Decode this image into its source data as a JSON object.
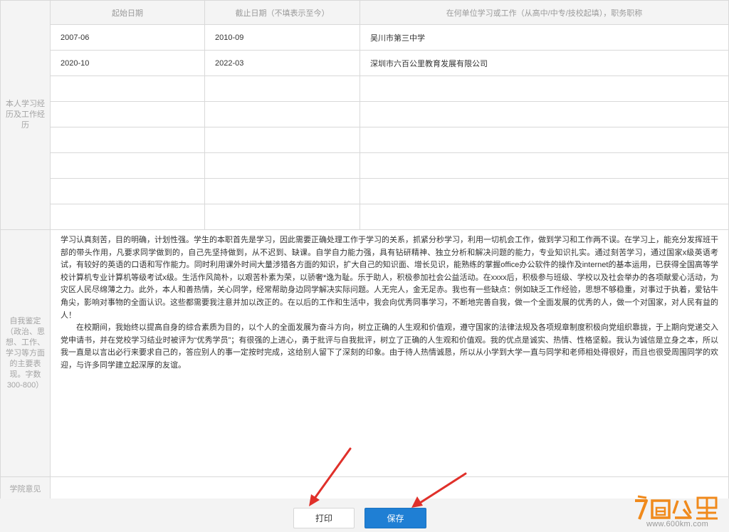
{
  "experience": {
    "section_label": "本人学习经历及工作经历",
    "headers": [
      "起始日期",
      "截止日期（不填表示至今）",
      "在何单位学习或工作（从高中/中专/技校起填），职务职称"
    ],
    "rows": [
      [
        "2007-06",
        "2010-09",
        "吴川市第三中学"
      ],
      [
        "2020-10",
        "2022-03",
        "深圳市六百公里教育发展有限公司"
      ],
      [
        "",
        "",
        ""
      ],
      [
        "",
        "",
        ""
      ],
      [
        "",
        "",
        ""
      ],
      [
        "",
        "",
        ""
      ],
      [
        "",
        "",
        ""
      ],
      [
        "",
        "",
        ""
      ]
    ]
  },
  "self_evaluation": {
    "label": "自我鉴定（政治、思想、工作、学习等方面的主要表现。字数300-800）",
    "paragraph1": "学习认真刻苦，目的明确，计划性强。学生的本职首先是学习，因此需要正确处理工作于学习的关系，抓紧分秒学习，利用一切机会工作，做到学习和工作两不误。在学习上，能充分发挥班干部的带头作用，凡要求同学做到的，自己先坚持做到，从不迟到、缺课。自学自力能力强，具有钻研精神、独立分析和解决问题的能力，专业知识扎实。通过刻苦学习，通过国家x级英语考试，有较好的英语的口语和写作能力。同时利用课外时间大量涉猎各方面的知识，扩大自己的知识面、增长见识，能熟练的掌握office办公软件的操作及internet的基本运用，已获得全国高等学校计算机专业计算机等级考试x级。生活作风简朴，以艰苦朴素为荣，以骄奢*逸为耻。乐于助人，积极参加社会公益活动。在xxxx后，积极参与班级、学校以及社会举办的各项献爱心活动，为灾区人民尽绵薄之力。此外，本人和善热情，关心同学，经常帮助身边同学解决实际问题。人无完人，金无足赤。我也有一些缺点：例如缺乏工作经验，思想不够稳重，对事过于执着，爱钻牛角尖，影响对事物的全面认识。这些都需要我注意并加以改正的。在以后的工作和生活中，我会向优秀同事学习，不断地完善自我，做一个全面发展的优秀的人，做一个对国家，对人民有益的人！",
    "paragraph2": "在校期间，我始终以提高自身的综合素质为目的，以个人的全面发展为奋斗方向，树立正确的人生观和价值观，遵守国家的法律法规及各项规章制度积极向党组织靠拢，于上期向党递交入党申请书，并在党校学习结业时被评为“优秀学员”；有很强的上进心，勇于批评与自我批评，树立了正确的人生观和价值观。我的优点是诚实、热情、性格坚毅。我认为诚信是立身之本，所以我一直是以言出必行来要求自己的，答应别人的事一定按时完成，这给别人留下了深刻的印象。由于待人热情诚恳，所以从小学到大学一直与同学和老师相处得很好，而且也很受周围同学的欢迎，与许多同学建立起深厚的友谊。"
  },
  "college_opinion": {
    "label": "学院意见",
    "value": ""
  },
  "buttons": {
    "print": "打印",
    "save": "保存"
  },
  "watermark": {
    "brand": "六百公里",
    "url": "www.600km.com"
  },
  "colors": {
    "primary": "#1f7fd4",
    "arrow": "#e0302a",
    "logo_orange": "#f08a1c"
  }
}
